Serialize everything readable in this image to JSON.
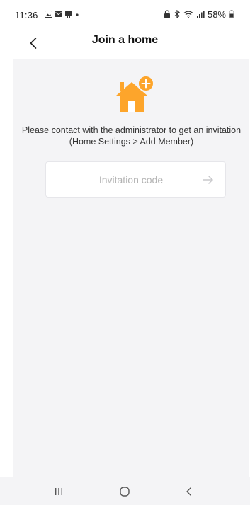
{
  "status_bar": {
    "time": "11:36",
    "battery": "58%",
    "left_icons": [
      "gallery-icon",
      "mail-icon",
      "app-icon",
      "dot-icon"
    ],
    "right_icons": [
      "lock-icon",
      "bluetooth-icon",
      "wifi-icon",
      "signal-icon",
      "battery-icon"
    ]
  },
  "header": {
    "title": "Join a home",
    "back_icon": "chevron-left-icon"
  },
  "main": {
    "icon": "house-add-icon",
    "instructions": "Please contact with the administrator to get an invitation (Home Settings > Add Member)",
    "code_input": {
      "value": "",
      "placeholder": "Invitation code"
    },
    "submit_icon": "arrow-right-icon"
  },
  "nav_bar": {
    "buttons": [
      "recent-apps-icon",
      "home-icon",
      "back-icon"
    ]
  },
  "colors": {
    "accent": "#fda52b",
    "content_bg": "#f4f4f6",
    "arrow": "#c9c9cc"
  }
}
